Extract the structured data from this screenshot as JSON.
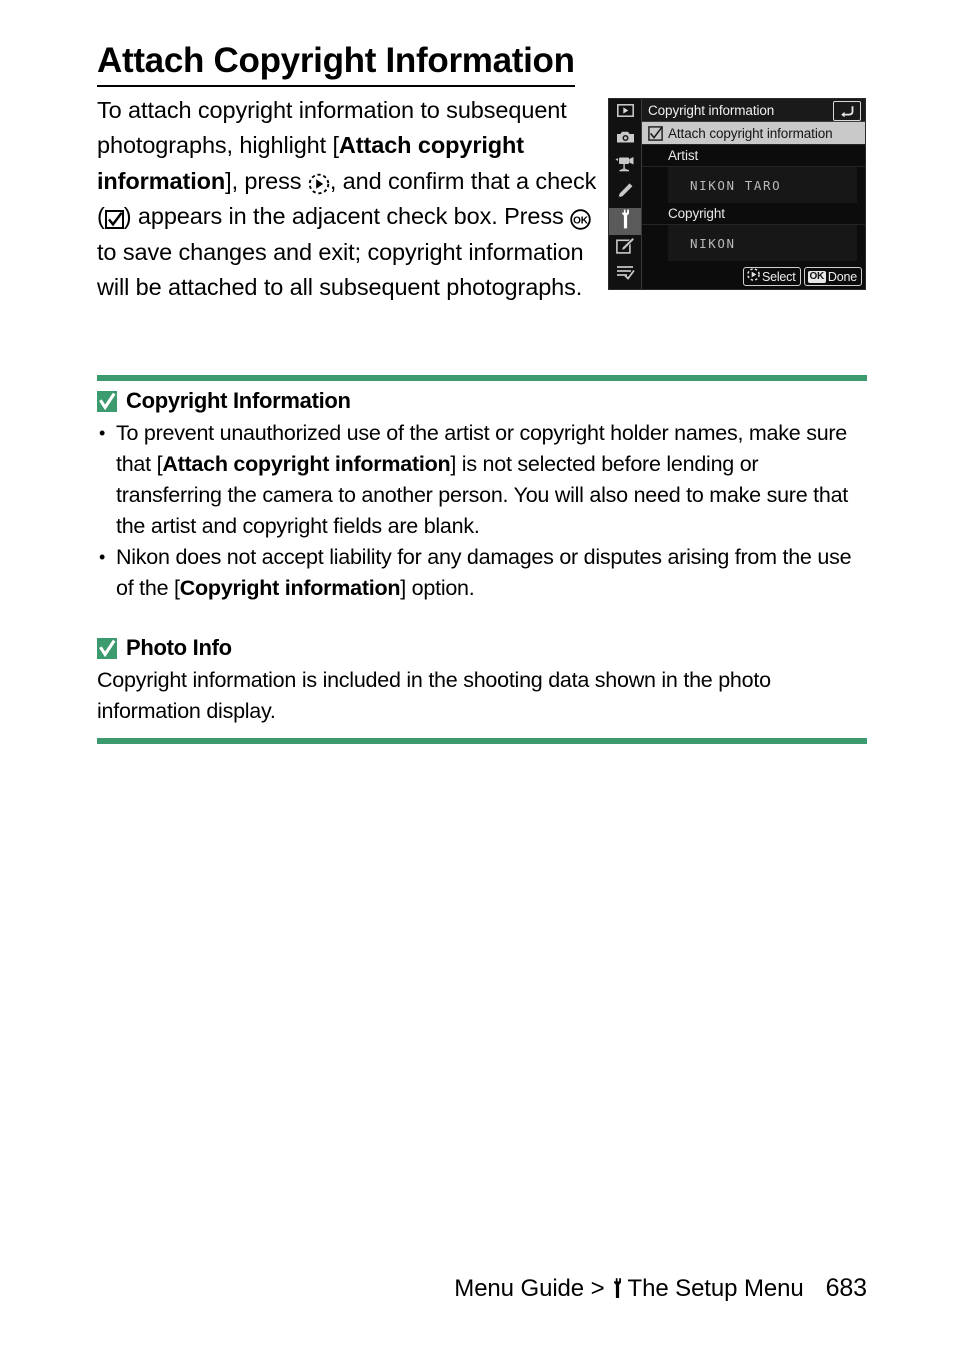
{
  "page": {
    "title": "Attach Copyright Information",
    "footer_path_prefix": "Menu Guide >",
    "footer_path_suffix": "The Setup Menu",
    "page_number": "683",
    "accent_green": "#3c9b6e",
    "rule_black": "#000000"
  },
  "intro": {
    "seg1": "To attach copyright information to subsequent photographs, highlight [",
    "bold1": "Attach copyright information",
    "seg2": "], press ",
    "icon_multiselector": "multi-selector-right-icon",
    "seg3": ", and confirm that a check (",
    "icon_checkbox": "checked-box-icon",
    "seg4": ") appears in the adjacent check box. Press ",
    "icon_ok": "ok-button-icon",
    "seg5": " to save changes and exit; copyright information will be attached to all subsequent photographs."
  },
  "lcd": {
    "header_title": "Copyright information",
    "back_icon": "return-arrow-icon",
    "rail": [
      {
        "name": "playback-menu-icon",
        "active": false
      },
      {
        "name": "photo-shooting-menu-icon",
        "active": false
      },
      {
        "name": "movie-shooting-menu-icon",
        "active": false
      },
      {
        "name": "custom-settings-menu-icon",
        "active": false
      },
      {
        "name": "setup-menu-icon",
        "active": true
      },
      {
        "name": "retouch-menu-icon",
        "active": false
      },
      {
        "name": "my-menu-icon",
        "active": false
      }
    ],
    "row_attach_label": "Attach copyright information",
    "row_attach_checked": true,
    "artist_label": "Artist",
    "artist_value": "NIKON TARO",
    "copyright_label": "Copyright",
    "copyright_value": "NIKON",
    "foot_select_label": "Select",
    "foot_done_badge": "OK",
    "foot_done_label": "Done"
  },
  "notes": [
    {
      "icon": "green-check-icon",
      "title": "Copyright Information",
      "bullets": [
        {
          "seg1": "To prevent unauthorized use of the artist or copyright holder names, make sure that [",
          "bold": "Attach copyright information",
          "seg2": "] is not selected before lending or transferring the camera to another person. You will also need to make sure that the artist and copyright fields are blank."
        },
        {
          "seg1": "Nikon does not accept liability for any damages or disputes arising from the use of the [",
          "bold": "Copyright information",
          "seg2": "] option."
        }
      ]
    },
    {
      "icon": "green-check-icon",
      "title": "Photo Info",
      "paragraph": "Copyright information is included in the shooting data shown in the photo information display."
    }
  ]
}
